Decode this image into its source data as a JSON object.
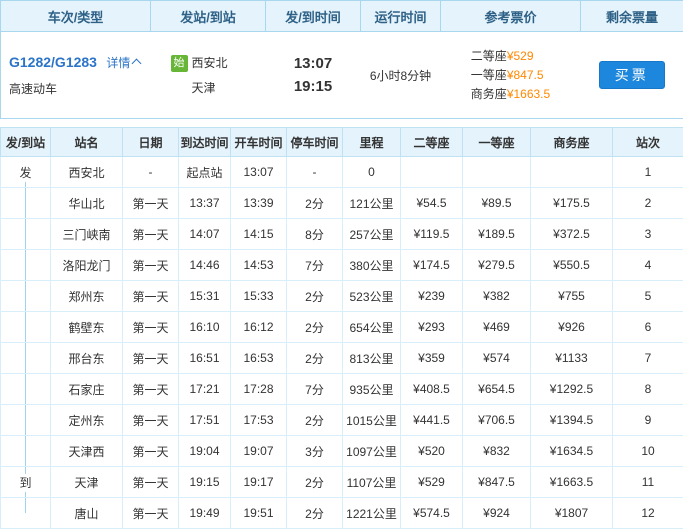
{
  "summary": {
    "headers": [
      "车次/类型",
      "发站/到站",
      "发/到时间",
      "运行时间",
      "参考票价",
      "剩余票量"
    ],
    "train_number": "G1282/G1283",
    "detail_label": "详情",
    "train_type": "高速动车",
    "origin_tag": "始",
    "origin": "西安北",
    "destination": "天津",
    "depart_time": "13:07",
    "arrive_time": "19:15",
    "duration": "6小时8分钟",
    "fares": [
      {
        "seat": "二等座",
        "price": "¥529"
      },
      {
        "seat": "一等座",
        "price": "¥847.5"
      },
      {
        "seat": "商务座",
        "price": "¥1663.5"
      }
    ],
    "buy_label": "买票"
  },
  "schedule": {
    "headers": [
      "发/到站",
      "站名",
      "日期",
      "到达时间",
      "开车时间",
      "停车时间",
      "里程",
      "二等座",
      "一等座",
      "商务座",
      "站次"
    ],
    "rows": [
      {
        "marker": "发",
        "line": "down",
        "station": "西安北",
        "date": "-",
        "arrive": "起点站",
        "depart": "13:07",
        "stop": "-",
        "distance": "0",
        "seat2": "",
        "seat1": "",
        "business": "",
        "no": "1"
      },
      {
        "marker": "",
        "line": "full",
        "station": "华山北",
        "date": "第一天",
        "arrive": "13:37",
        "depart": "13:39",
        "stop": "2分",
        "distance": "121公里",
        "seat2": "¥54.5",
        "seat1": "¥89.5",
        "business": "¥175.5",
        "no": "2"
      },
      {
        "marker": "",
        "line": "full",
        "station": "三门峡南",
        "date": "第一天",
        "arrive": "14:07",
        "depart": "14:15",
        "stop": "8分",
        "distance": "257公里",
        "seat2": "¥119.5",
        "seat1": "¥189.5",
        "business": "¥372.5",
        "no": "3"
      },
      {
        "marker": "",
        "line": "full",
        "station": "洛阳龙门",
        "date": "第一天",
        "arrive": "14:46",
        "depart": "14:53",
        "stop": "7分",
        "distance": "380公里",
        "seat2": "¥174.5",
        "seat1": "¥279.5",
        "business": "¥550.5",
        "no": "4"
      },
      {
        "marker": "",
        "line": "full",
        "station": "郑州东",
        "date": "第一天",
        "arrive": "15:31",
        "depart": "15:33",
        "stop": "2分",
        "distance": "523公里",
        "seat2": "¥239",
        "seat1": "¥382",
        "business": "¥755",
        "no": "5"
      },
      {
        "marker": "",
        "line": "full",
        "station": "鹤壁东",
        "date": "第一天",
        "arrive": "16:10",
        "depart": "16:12",
        "stop": "2分",
        "distance": "654公里",
        "seat2": "¥293",
        "seat1": "¥469",
        "business": "¥926",
        "no": "6"
      },
      {
        "marker": "",
        "line": "full",
        "station": "邢台东",
        "date": "第一天",
        "arrive": "16:51",
        "depart": "16:53",
        "stop": "2分",
        "distance": "813公里",
        "seat2": "¥359",
        "seat1": "¥574",
        "business": "¥1133",
        "no": "7"
      },
      {
        "marker": "",
        "line": "full",
        "station": "石家庄",
        "date": "第一天",
        "arrive": "17:21",
        "depart": "17:28",
        "stop": "7分",
        "distance": "935公里",
        "seat2": "¥408.5",
        "seat1": "¥654.5",
        "business": "¥1292.5",
        "no": "8"
      },
      {
        "marker": "",
        "line": "full",
        "station": "定州东",
        "date": "第一天",
        "arrive": "17:51",
        "depart": "17:53",
        "stop": "2分",
        "distance": "1015公里",
        "seat2": "¥441.5",
        "seat1": "¥706.5",
        "business": "¥1394.5",
        "no": "9"
      },
      {
        "marker": "",
        "line": "full",
        "station": "天津西",
        "date": "第一天",
        "arrive": "19:04",
        "depart": "19:07",
        "stop": "3分",
        "distance": "1097公里",
        "seat2": "¥520",
        "seat1": "¥832",
        "business": "¥1634.5",
        "no": "10"
      },
      {
        "marker": "到",
        "line": "full",
        "station": "天津",
        "date": "第一天",
        "arrive": "19:15",
        "depart": "19:17",
        "stop": "2分",
        "distance": "1107公里",
        "seat2": "¥529",
        "seat1": "¥847.5",
        "business": "¥1663.5",
        "no": "11"
      },
      {
        "marker": "",
        "line": "up",
        "station": "唐山",
        "date": "第一天",
        "arrive": "19:49",
        "depart": "19:51",
        "stop": "2分",
        "distance": "1221公里",
        "seat2": "¥574.5",
        "seat1": "¥924",
        "business": "¥1807",
        "no": "12"
      }
    ]
  },
  "colors": {
    "accent_blue": "#2b74c8",
    "price_orange": "#ff8800",
    "buy_button_blue": "#1c87dd",
    "origin_tag_green": "#67b637",
    "header_bg": "#e4f3fc",
    "border_blue": "#a9d7ee"
  }
}
